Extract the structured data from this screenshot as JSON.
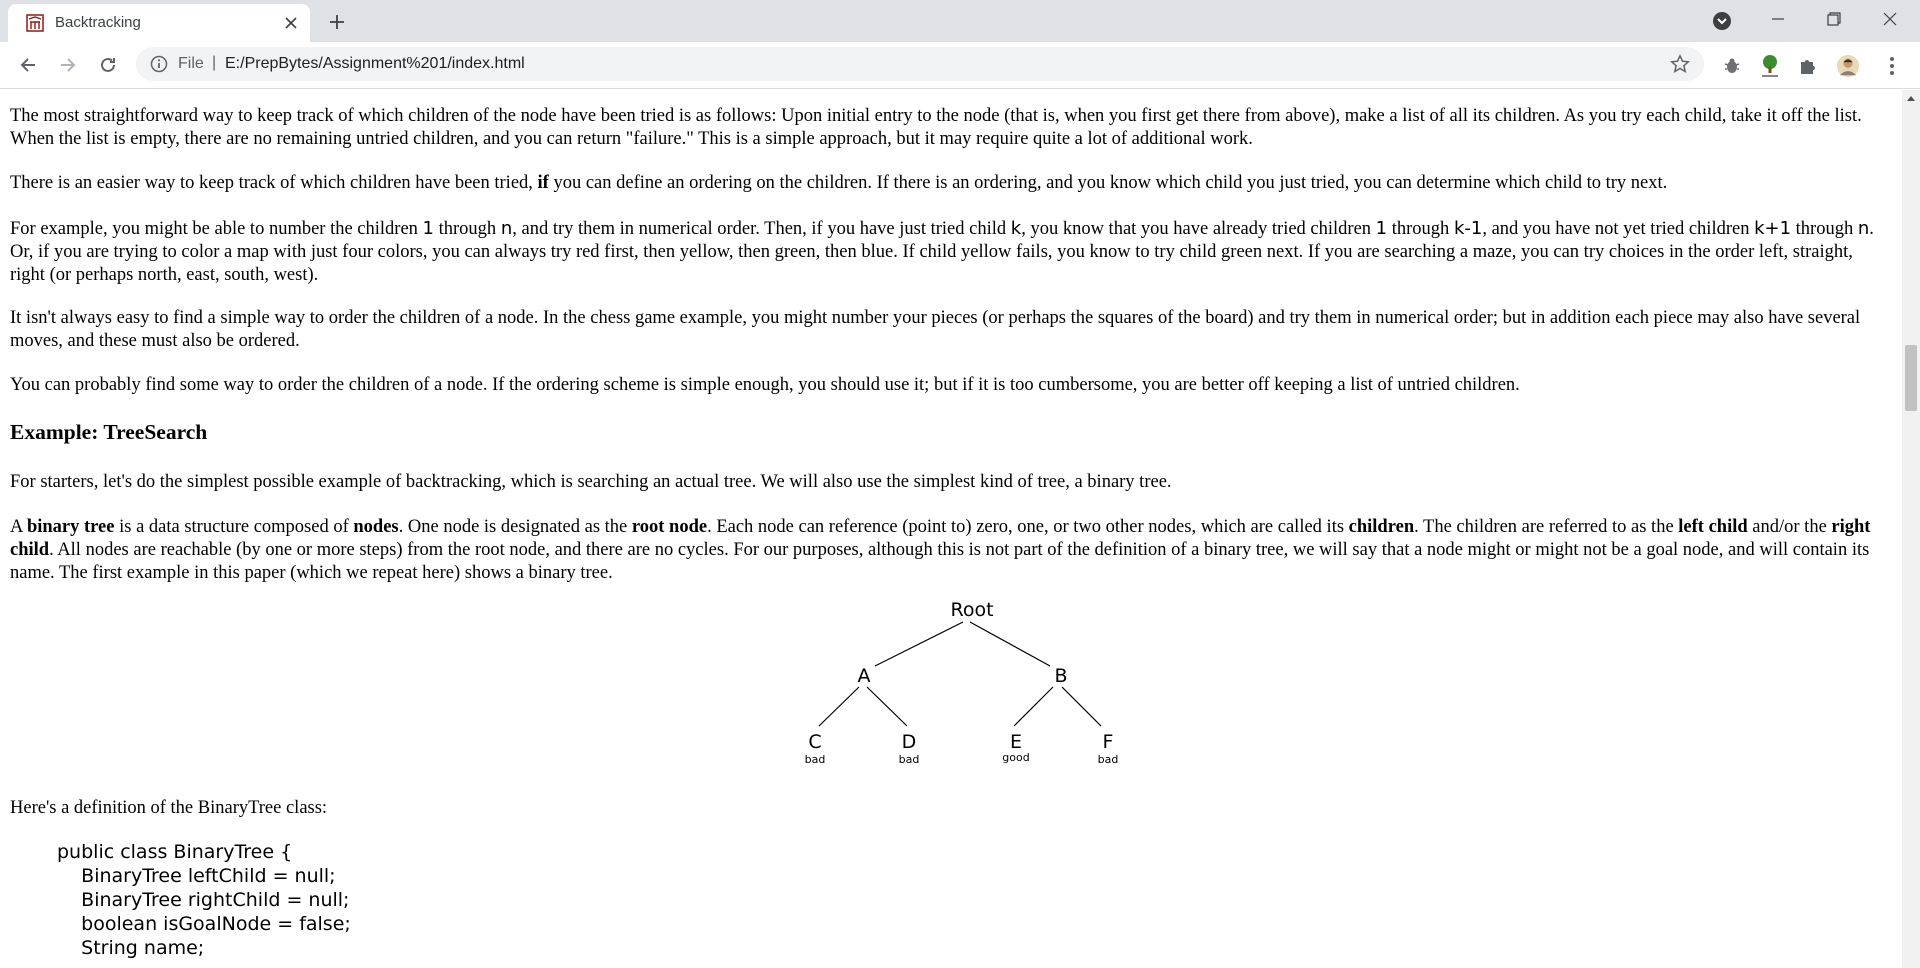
{
  "browser": {
    "tab_title": "Backtracking",
    "omnibox_file_label": "File",
    "omnibox_separator": "|",
    "url": "E:/PrepBytes/Assignment%201/index.html",
    "icons": [
      "favicon-icon",
      "close-icon",
      "plus-icon",
      "tab-search-icon",
      "minimize-icon",
      "maximize-icon",
      "close-window-icon",
      "back-arrow-icon",
      "forward-arrow-icon",
      "reload-icon",
      "info-icon",
      "star-icon",
      "bug-extension-icon",
      "tree-extension-icon",
      "puzzle-extension-icon",
      "avatar",
      "kebab-menu-icon"
    ]
  },
  "page": {
    "p1": "The most straightforward way to keep track of which children of the node have been tried is as follows: Upon initial entry to the node (that is, when you first get there from above), make a list of all its children. As you try each child, take it off the list. When the list is empty, there are no remaining untried children, and you can return \"failure.\" This is a simple approach, but it may require quite a lot of additional work.",
    "p2": {
      "before": "There is an easier way to keep track of which children have been tried, ",
      "bold": "if",
      "after": " you can define an ordering on the children. If there is an ordering, and you know which child you just tried, you can determine which child to try next."
    },
    "p3": {
      "t1": "For example, you might be able to number the children ",
      "c1": "1",
      "t2": " through ",
      "c2": "n",
      "t3": ", and try them in numerical order. Then, if you have just tried child ",
      "c3": "k",
      "t4": ", you know that you have already tried children ",
      "c4": "1",
      "t5": " through ",
      "c5": "k-1",
      "t6": ", and you have not yet tried children ",
      "c6": "k+1",
      "t7": " through ",
      "c7": "n",
      "t8": ". Or, if you are trying to color a map with just four colors, you can always try red first, then yellow, then green, then blue. If child yellow fails, you know to try child green next. If you are searching a maze, you can try choices in the order left, straight, right (or perhaps north, east, south, west)."
    },
    "p4": "It isn't always easy to find a simple way to order the children of a node. In the chess game example, you might number your pieces (or perhaps the squares of the board) and try them in numerical order; but in addition each piece may also have several moves, and these must also be ordered.",
    "p5": "You can probably find some way to order the children of a node. If the ordering scheme is simple enough, you should use it; but if it is too cumbersome, you are better off keeping a list of untried children.",
    "heading": "Example: TreeSearch",
    "p6": "For starters, let's do the simplest possible example of backtracking, which is searching an actual tree. We will also use the simplest kind of tree, a binary tree.",
    "p7": {
      "t1": "A ",
      "b1": "binary tree",
      "t2": " is a data structure composed of ",
      "b2": "nodes",
      "t3": ". One node is designated as the ",
      "b3": "root node",
      "t4": ". Each node can reference (point to) zero, one, or two other nodes, which are called its ",
      "b4": "children",
      "t5": ". The children are referred to as the ",
      "b5": "left child",
      "t6": " and/or the ",
      "b6": "right child",
      "t7": ". All nodes are reachable (by one or more steps) from the root node, and there are no cycles. For our purposes, although this is not part of the definition of a binary tree, we will say that a node might or might not be a goal node, and will contain its name. The first example in this paper (which we repeat here) shows a binary tree."
    },
    "tree": {
      "root": "Root",
      "a": "A",
      "b": "B",
      "c": "C",
      "c_sub": "bad",
      "d": "D",
      "d_sub": "bad",
      "e": "E",
      "e_sub": "good",
      "f": "F",
      "f_sub": "bad"
    },
    "p8": "Here's a definition of the BinaryTree class:",
    "code": [
      "public class BinaryTree {",
      "    BinaryTree leftChild = null;",
      "    BinaryTree rightChild = null;",
      "    boolean isGoalNode = false;",
      "    String name;"
    ]
  }
}
